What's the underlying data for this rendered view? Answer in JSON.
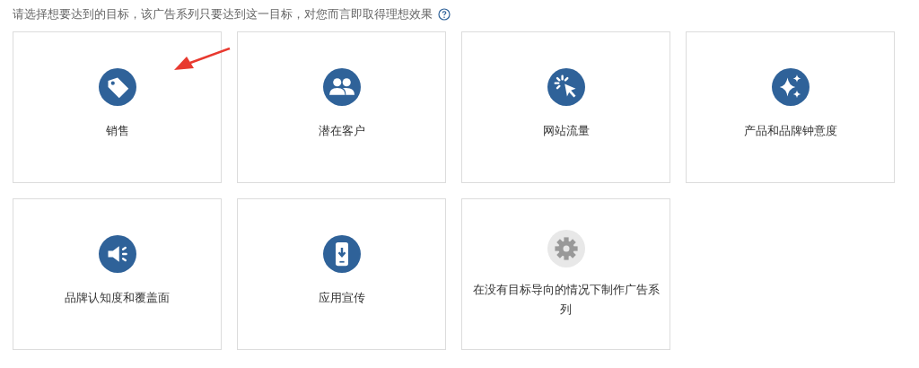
{
  "heading": "请选择想要达到的目标，该广告系列只要达到这一目标，对您而言即取得理想效果",
  "goals": [
    {
      "label": "销售",
      "kind": "goal"
    },
    {
      "label": "潜在客户",
      "kind": "goal"
    },
    {
      "label": "网站流量",
      "kind": "goal"
    },
    {
      "label": "产品和品牌钟意度",
      "kind": "goal"
    },
    {
      "label": "品牌认知度和覆盖面",
      "kind": "goal"
    },
    {
      "label": "应用宣传",
      "kind": "goal"
    },
    {
      "label": "在没有目标导向的情况下制作广告系列",
      "kind": "none"
    }
  ]
}
